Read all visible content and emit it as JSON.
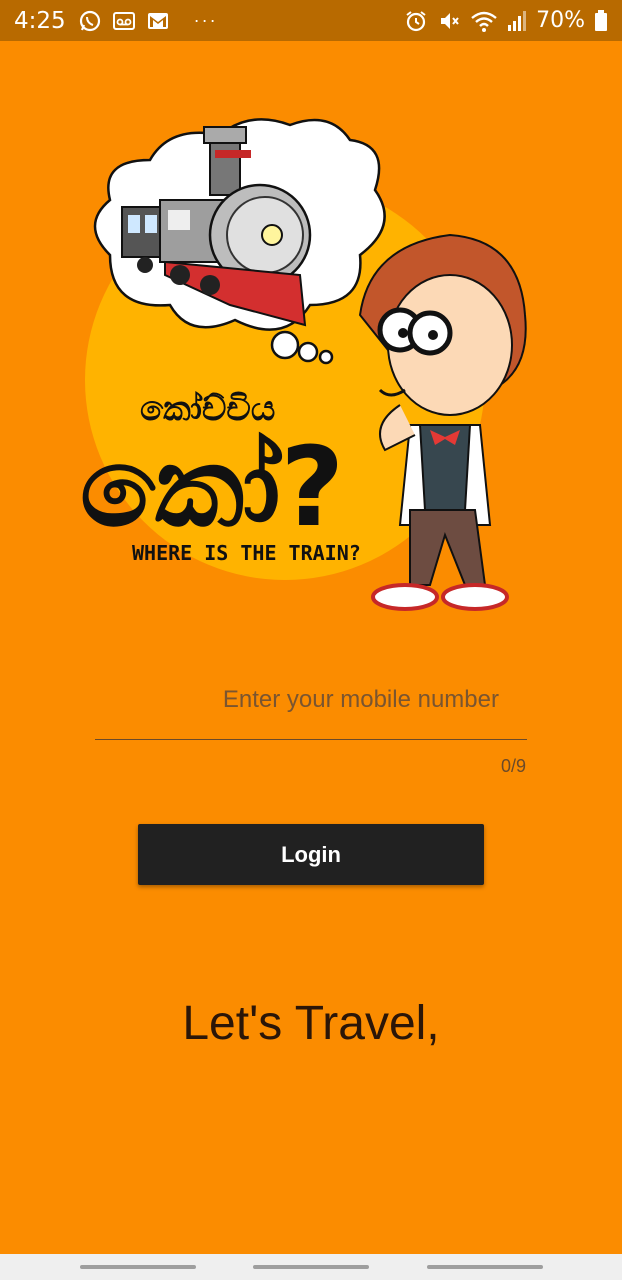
{
  "status_bar": {
    "time": "4:25",
    "battery_percent": "70%",
    "icons_left": [
      "whatsapp-icon",
      "voicemail-icon",
      "gmail-icon",
      "more-dots-icon"
    ],
    "icons_right": [
      "alarm-icon",
      "mute-icon",
      "wifi-icon",
      "signal-icon",
      "battery-icon"
    ],
    "more_dots": "···"
  },
  "hero": {
    "sinhala_small": "කෝච්චිය",
    "sinhala_big": "කෝ?",
    "subtitle": "WHERE IS THE TRAIN?"
  },
  "form": {
    "mobile_placeholder": "Enter your mobile number",
    "mobile_value": "",
    "counter": "0/9",
    "login_label": "Login"
  },
  "tagline": "Let's Travel,",
  "colors": {
    "background": "#FB8C00",
    "status_bar": "#B86A00",
    "button": "#212121",
    "sun": "#FFB300"
  }
}
